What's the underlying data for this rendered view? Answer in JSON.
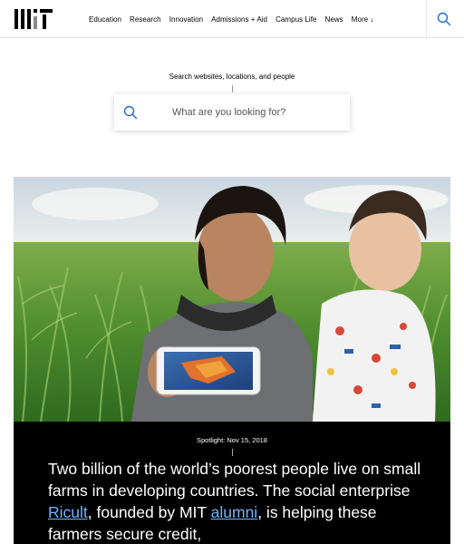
{
  "header": {
    "logo_text": "MIT",
    "nav": [
      "Education",
      "Research",
      "Innovation",
      "Admissions + Aid",
      "Campus Life",
      "News"
    ],
    "more_label": "More",
    "search_icon": "search-icon"
  },
  "search": {
    "label": "Search websites, locations, and people",
    "placeholder": "What are you looking for?",
    "icon": "search-icon"
  },
  "spotlight": {
    "kicker": "Spotlight: Nov 15, 2018",
    "headline_part1": "Two billion of the world’s poorest people live on small farms in developing countries. The social enterprise ",
    "link1": "Ricult",
    "headline_part2": ", founded by MIT ",
    "link2": "alumni",
    "headline_part3": ", is helping these farmers secure credit,"
  },
  "colors": {
    "link": "#6fb2ff",
    "search_icon": "#1f6fd1",
    "logo_grey": "#8a8b8c",
    "panel": "#000000"
  }
}
